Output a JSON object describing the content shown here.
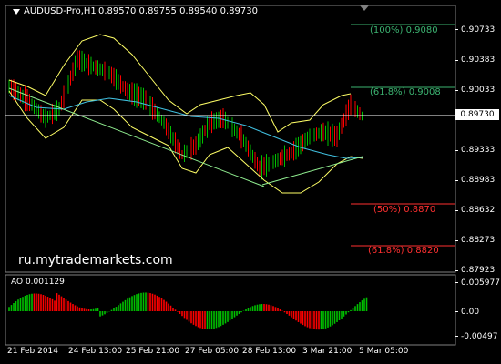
{
  "header": {
    "symbol": "AUDUSD-Pro,H1",
    "ohlc": "0.89570 0.89755 0.89540 0.89730"
  },
  "price_axis": {
    "labels": [
      "0.90733",
      "0.90383",
      "0.90033",
      "0.89333",
      "0.88983",
      "0.88632",
      "0.88273",
      "0.87923"
    ],
    "current_price": "0.89730"
  },
  "fib_levels": [
    {
      "label": "(100%) 0.9080",
      "color": "#3cb371"
    },
    {
      "label": "(61.8%) 0.9008",
      "color": "#3cb371"
    },
    {
      "label": "(50%) 0.8870",
      "color": "#ff3030"
    },
    {
      "label": "(61.8%) 0.8820",
      "color": "#ff3030"
    }
  ],
  "watermark": "ru.mytrademarkets.com",
  "ao_panel": {
    "title": "AO 0.001129",
    "axis_labels": [
      "0.005977",
      "0.00",
      "-0.00497"
    ]
  },
  "time_axis": [
    "21 Feb 2014",
    "24 Feb 13:00",
    "25 Feb 21:00",
    "27 Feb 05:00",
    "28 Feb 13:00",
    "3 Mar 21:00",
    "5 Mar 05:00"
  ],
  "colors": {
    "background": "#000000",
    "bull_bar": "#00c000",
    "bear_bar": "#ff0000",
    "bollinger": "#ffff66",
    "moving_average": "#40c0e0",
    "trendline": "#90ee90",
    "grid_line": "#ffffff"
  },
  "icons": {
    "scroll_marker": "triangle-down"
  }
}
